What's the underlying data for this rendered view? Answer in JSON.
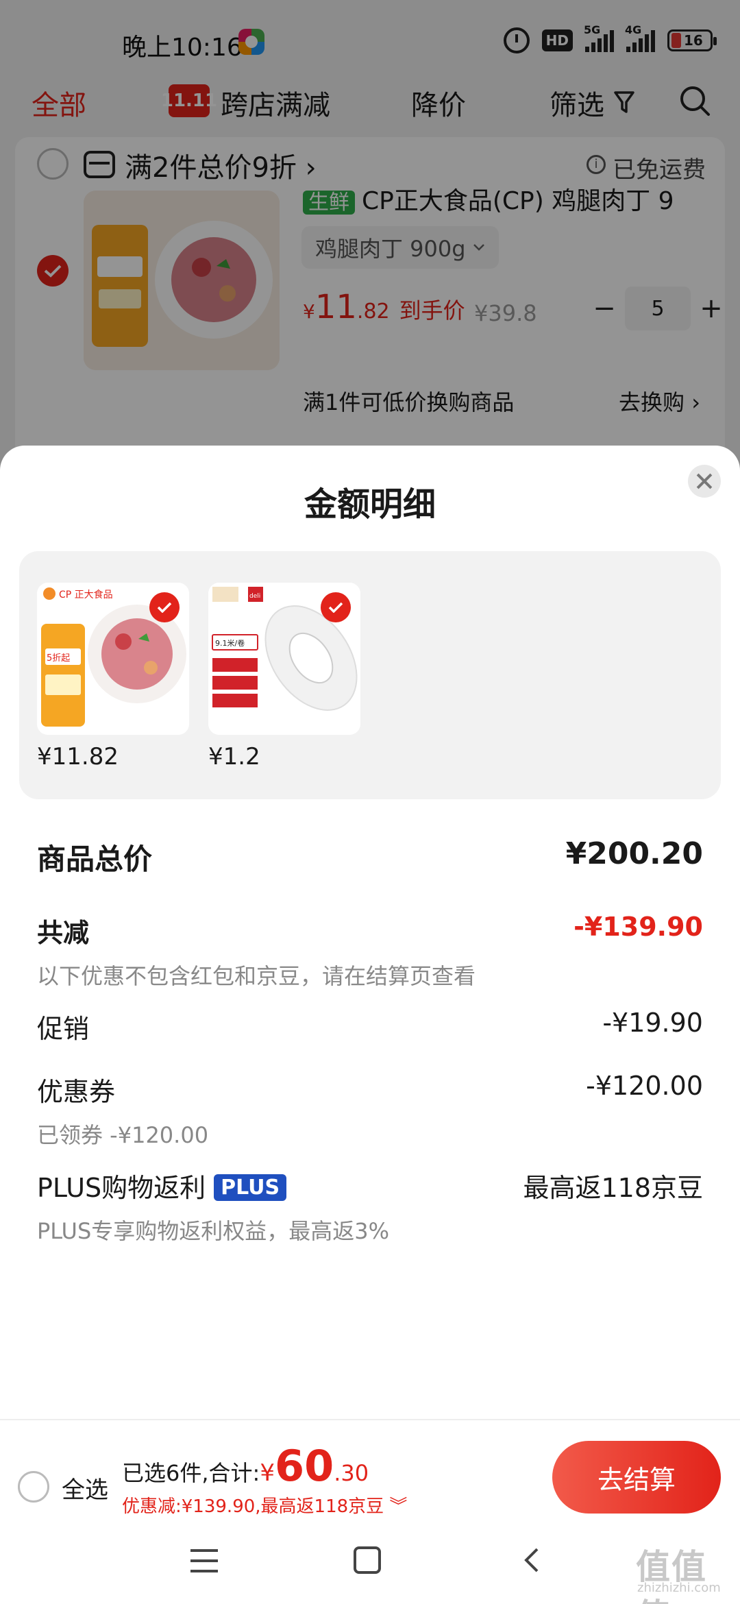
{
  "status_bar": {
    "time": "晚上10:16",
    "hd_label": "HD",
    "network_1": "5G",
    "network_2": "4G",
    "battery": "16"
  },
  "top_nav": {
    "all_tab": "全部",
    "event_icon_text": "11.11",
    "cross_store_tab": "跨店满减",
    "price_drop_tab": "降价",
    "filter_tab": "筛选"
  },
  "cart_card": {
    "promo_text": "满2件总价9折 ›",
    "shipping_text": "已免运费",
    "item": {
      "tag": "生鲜",
      "title": "CP正大食品(CP) 鸡腿肉丁 9",
      "sku": "鸡腿肉丁 900g",
      "price_symbol": "¥",
      "price_int": "11",
      "price_dec": ".82",
      "price_label": "到手价",
      "original_price": "¥39.8",
      "quantity": "5",
      "qty_minus": "−",
      "qty_plus": "+"
    },
    "swap_text": "满1件可低价换购商品",
    "swap_link": "去换购 ›"
  },
  "sheet": {
    "title": "金额明细",
    "products": [
      {
        "price": "¥11.82",
        "brand": "CP 正大食品",
        "badge": "5折起"
      },
      {
        "price": "¥1.2",
        "brand": "deli",
        "badge": "9.1米/卷"
      }
    ],
    "total": {
      "label": "商品总价",
      "value": "¥200.20"
    },
    "discount": {
      "label": "共减",
      "value": "-¥139.90",
      "note": "以下优惠不包含红包和京豆，请在结算页查看"
    },
    "promotion": {
      "label": "促销",
      "value": "-¥19.90"
    },
    "coupon": {
      "label": "优惠券",
      "value": "-¥120.00",
      "note": "已领券 -¥120.00"
    },
    "plus": {
      "label": "PLUS购物返利",
      "badge": "PLUS",
      "value": "最高返118京豆",
      "note": "PLUS专享购物返利权益，最高返3%"
    }
  },
  "checkout": {
    "select_all": "全选",
    "summary_prefix": "已选6件,合计:",
    "sum_symbol": "¥",
    "sum_int": "60",
    "sum_dec": ".30",
    "discount_text": "优惠减:¥139.90,最高返118京豆 ︾",
    "button": "去结算"
  },
  "watermark": {
    "main": "值值值",
    "sub": "zhizhizhi.com"
  },
  "colors": {
    "accent": "#e2231a",
    "plus_badge": "#1f4fbf",
    "fresh_tag": "#2fae4b"
  }
}
